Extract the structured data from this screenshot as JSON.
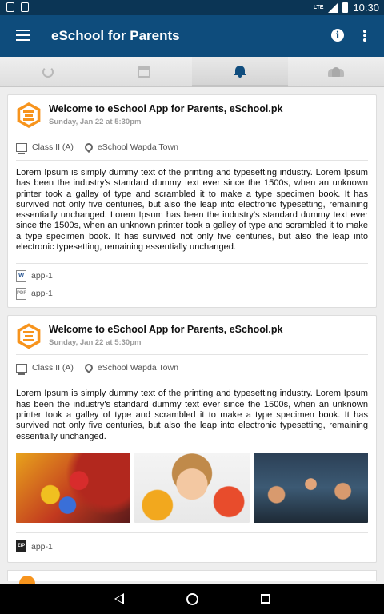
{
  "status_bar": {
    "time": "10:30",
    "network": "LTE"
  },
  "app_bar": {
    "title": "eSchool for Parents"
  },
  "tabs": [
    {
      "name": "sync"
    },
    {
      "name": "calendar"
    },
    {
      "name": "notifications",
      "active": true
    },
    {
      "name": "groups"
    }
  ],
  "cards": [
    {
      "title": "Welcome to eSchool App for Parents, eSchool.pk",
      "date": "Sunday, Jan 22 at 5:30pm",
      "class_label": "Class II (A)",
      "location": "eSchool Wapda Town",
      "body": "Lorem Ipsum is simply dummy text of the printing and typesetting industry. Lorem Ipsum has been the industry's standard dummy text ever since the 1500s, when an unknown printer took a galley of type and scrambled it to make a type specimen book. It has survived not only five centuries, but also the leap into electronic typesetting, remaining essentially unchanged. Lorem Ipsum has been the industry's standard dummy text ever since the 1500s, when an unknown printer took a galley of type and scrambled it to make a type specimen book. It has survived not only five centuries, but also the leap into electronic typesetting, remaining essentially unchanged.",
      "attachments": [
        {
          "type": "word",
          "icon": "W",
          "name": "app-1"
        },
        {
          "type": "pdf",
          "icon": "PDF",
          "name": "app-1"
        }
      ]
    },
    {
      "title": "Welcome to eSchool App for Parents, eSchool.pk",
      "date": "Sunday, Jan 22 at 5:30pm",
      "class_label": "Class II (A)",
      "location": "eSchool Wapda Town",
      "body": "Lorem Ipsum is simply dummy text of the printing and typesetting industry. Lorem Ipsum has been the industry's standard dummy text ever since the 1500s, when an unknown printer took a galley of type and scrambled it to make a type specimen book. It has survived not only five centuries, but also the leap into electronic typesetting, remaining essentially unchanged.",
      "photos": [
        "crayons",
        "child-painted-hands",
        "classroom-raised-hands"
      ],
      "attachments": [
        {
          "type": "zip",
          "icon": "ZIP",
          "name": "app-1"
        }
      ]
    }
  ],
  "colors": {
    "primary": "#0e4c7c",
    "status": "#0b3555",
    "accent": "#f7941d"
  }
}
